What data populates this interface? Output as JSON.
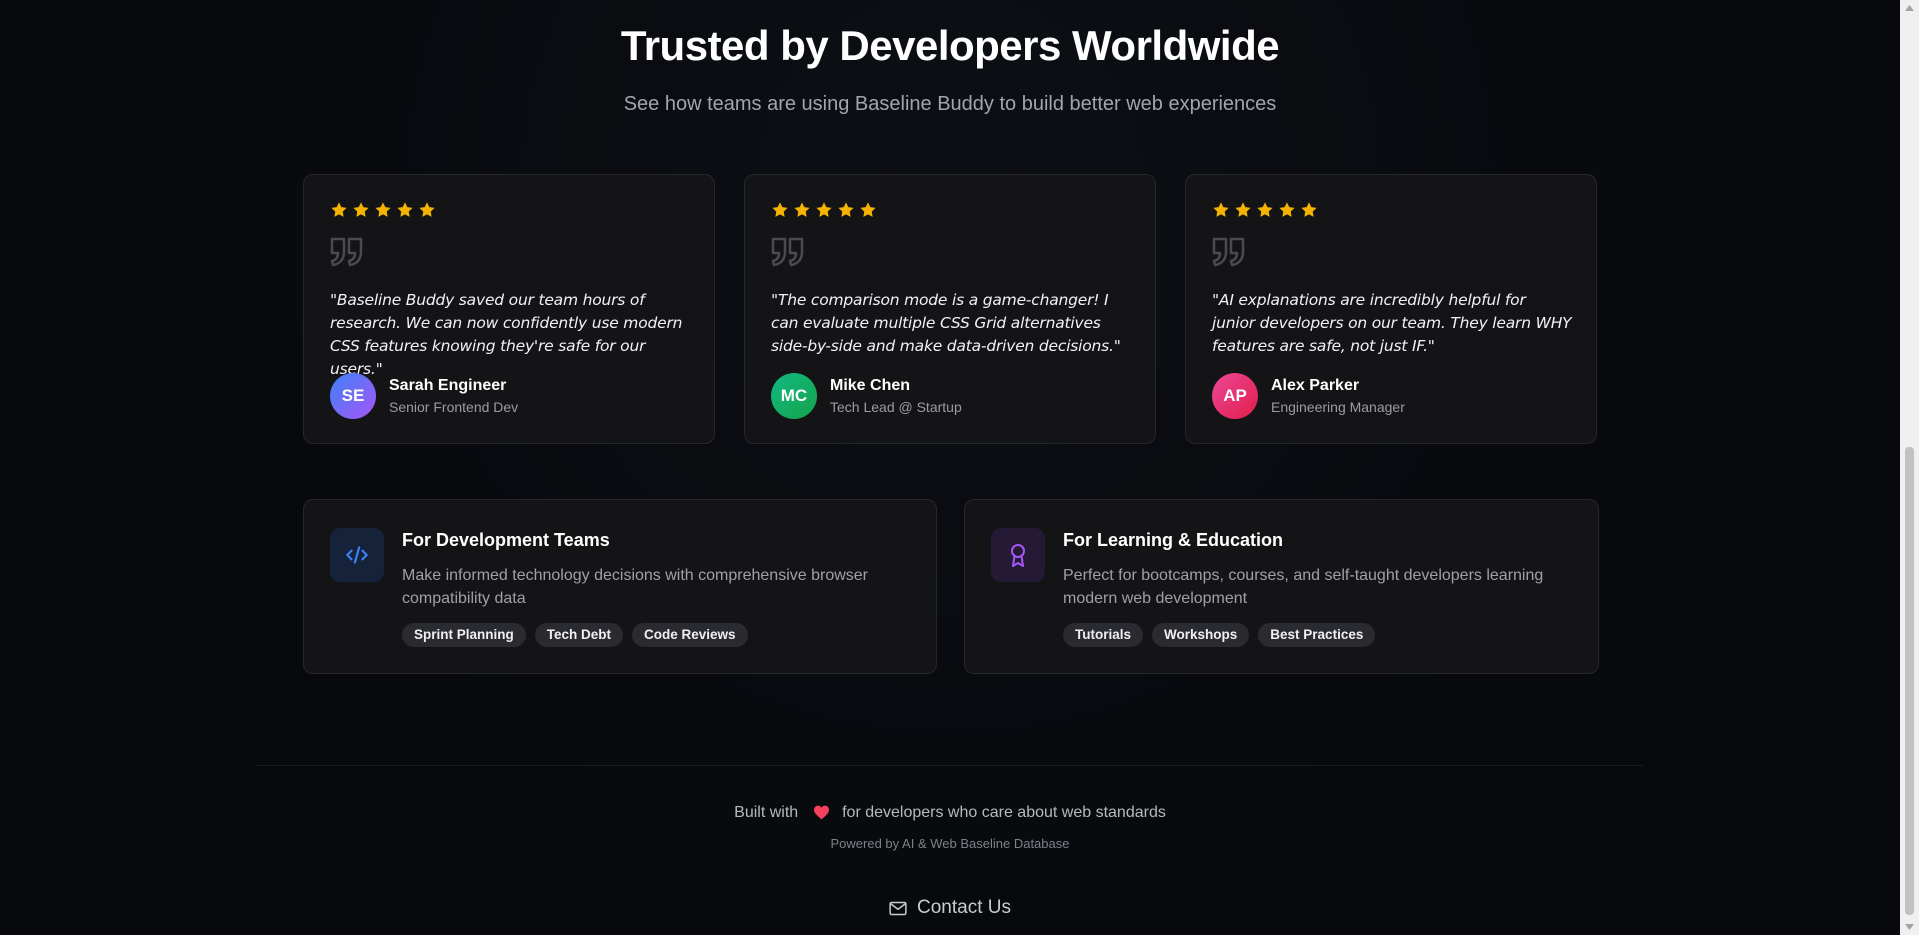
{
  "header": {
    "title": "Trusted by Developers Worldwide",
    "subtitle": "See how teams are using Baseline Buddy to build better web experiences"
  },
  "testimonials": [
    {
      "rating": 5,
      "quote": "\"Baseline Buddy saved our team hours of research. We can now confidently use modern CSS features knowing they're safe for our users.\"",
      "initials": "SE",
      "name": "Sarah Engineer",
      "role": "Senior Frontend Dev",
      "avatar_colors": [
        "#3b82f6",
        "#a855f7"
      ]
    },
    {
      "rating": 5,
      "quote": "\"The comparison mode is a game-changer! I can evaluate multiple CSS Grid alternatives side-by-side and make data-driven decisions.\"",
      "initials": "MC",
      "name": "Mike Chen",
      "role": "Tech Lead @ Startup",
      "avatar_colors": [
        "#10b981",
        "#16a34a"
      ]
    },
    {
      "rating": 5,
      "quote": "\"AI explanations are incredibly helpful for junior developers on our team. They learn WHY features are safe, not just IF.\"",
      "initials": "AP",
      "name": "Alex Parker",
      "role": "Engineering Manager",
      "avatar_colors": [
        "#ec4899",
        "#e11d48"
      ]
    }
  ],
  "use_cases": [
    {
      "icon": "code-icon",
      "accent": "#3b82f6",
      "title": "For Development Teams",
      "description": "Make informed technology decisions with comprehensive browser compatibility data",
      "tags": [
        "Sprint Planning",
        "Tech Debt",
        "Code Reviews"
      ]
    },
    {
      "icon": "award-icon",
      "accent": "#a855f7",
      "title": "For Learning & Education",
      "description": "Perfect for bootcamps, courses, and self-taught developers learning modern web development",
      "tags": [
        "Tutorials",
        "Workshops",
        "Best Practices"
      ]
    }
  ],
  "footer": {
    "built_prefix": "Built with",
    "built_suffix": "for developers who care about web standards",
    "powered_by": "Powered by AI & Web Baseline Database",
    "contact_label": "Contact Us"
  },
  "colors": {
    "star": "#f5b301",
    "heart": "#f43f5e",
    "background": "#07090d",
    "card": "#141417"
  }
}
